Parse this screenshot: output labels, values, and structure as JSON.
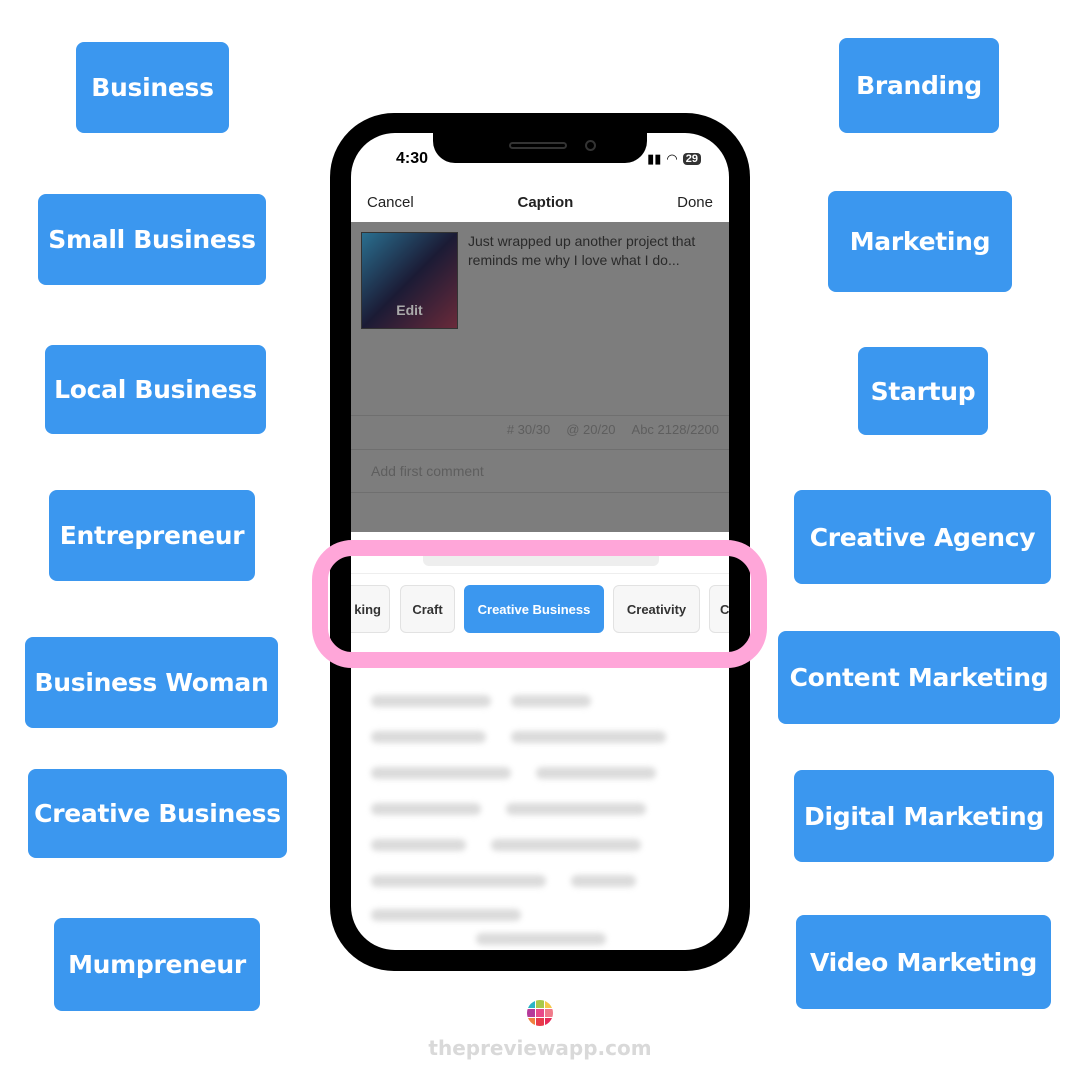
{
  "left_tags": [
    "Business",
    "Small Business",
    "Local Business",
    "Entrepreneur",
    "Business Woman",
    "Creative Business",
    "Mumpreneur"
  ],
  "right_tags": [
    "Branding",
    "Marketing",
    "Startup",
    "Creative Agency",
    "Content Marketing",
    "Digital Marketing",
    "Video Marketing"
  ],
  "status": {
    "time": "4:30",
    "battery": "29"
  },
  "nav": {
    "cancel": "Cancel",
    "title": "Caption",
    "done": "Done"
  },
  "post": {
    "edit_label": "Edit",
    "caption": "Just wrapped up another project that reminds me why I love what I do..."
  },
  "counts": {
    "hashtags": "# 30/30",
    "mentions": "@ 20/20",
    "characters": "Abc 2128/2200"
  },
  "comment_placeholder": "Add first comment",
  "chips": [
    {
      "label": "king"
    },
    {
      "label": "Craft"
    },
    {
      "label": "Creative Business",
      "active": true
    },
    {
      "label": "Creativity"
    },
    {
      "label": "C"
    }
  ],
  "colors": {
    "tag_blue": "#3b97ef",
    "highlight_pink": "#ffa6d9"
  },
  "footer": {
    "site": "thepreviewapp.com"
  }
}
